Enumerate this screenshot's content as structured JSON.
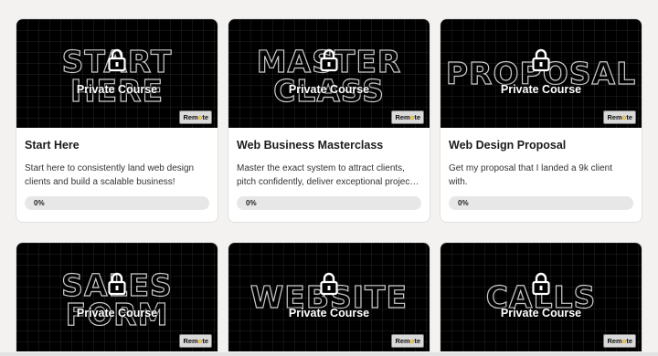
{
  "courses": [
    {
      "overlay_text": "Private Course",
      "title": "Start Here",
      "description": "Start here to consistently land web design clients and build a scalable business!",
      "progress": "0%",
      "badge": "Remote"
    },
    {
      "overlay_text": "Private Course",
      "title": "Web Business Masterclass",
      "description": "Master the exact system to attract clients, pitch confidently, deliver exceptional projects and grow your business.",
      "progress": "0%",
      "badge": "Remote"
    },
    {
      "overlay_text": "Private Course",
      "title": "Web Design Proposal",
      "description": "Get my proposal that I landed a 9k client with.",
      "progress": "0%",
      "badge": "Remote"
    },
    {
      "overlay_text": "Private Course",
      "badge": "Remote"
    },
    {
      "overlay_text": "Private Course",
      "badge": "Remote"
    },
    {
      "overlay_text": "Private Course",
      "badge": "Remote"
    }
  ],
  "thumbnail_art": [
    "START HERE",
    "MASTER CLASS",
    "PROPOSAL",
    "SALES FORM",
    "WEBSITE",
    "CALLS"
  ],
  "icons": {
    "lock": "lock-icon"
  }
}
